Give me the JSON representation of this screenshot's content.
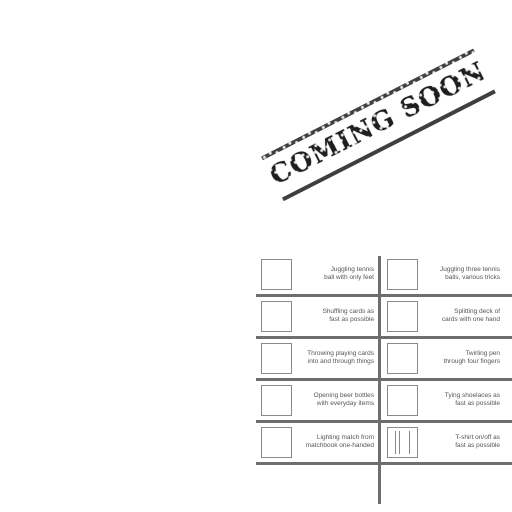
{
  "stamp": {
    "text": "COMING SOON"
  },
  "cells": [
    {
      "label": "Juggling tennis\nball with only feet"
    },
    {
      "label": "Juggling three tennis\nballs, various tricks"
    },
    {
      "label": "Shuffling cards as\nfast as possible"
    },
    {
      "label": "Splitting deck of\ncards with one hand"
    },
    {
      "label": "Throwing playing cards\ninto and through things"
    },
    {
      "label": "Twirling pen\nthrough four fingers"
    },
    {
      "label": "Opening beer bottles\nwith everyday items"
    },
    {
      "label": "Tying shoelaces as\nfast as possible"
    },
    {
      "label": "Lighting match from\nmatchbook one-handed"
    },
    {
      "label": "T-shirt on/off as\nfast as possible"
    }
  ]
}
